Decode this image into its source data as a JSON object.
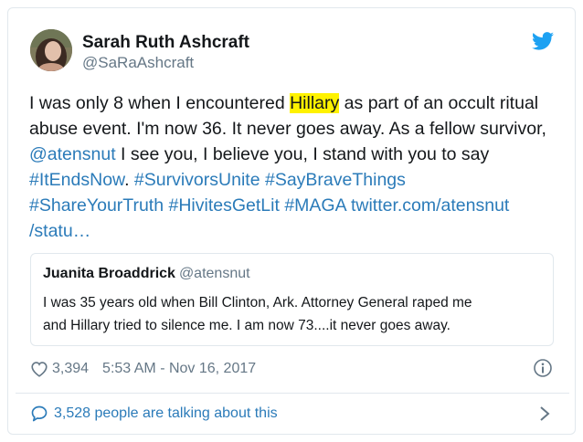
{
  "tweet": {
    "author_name": "Sarah Ruth Ashcraft",
    "author_handle": "@SaRaAshcraft",
    "text": {
      "part1": "I was only 8 when I encountered ",
      "highlight": "Hillary",
      "part2": " as part of an occult ritual abuse event. I'm now 36. It never goes away. As a fellow survivor, ",
      "mention": "@atensnut",
      "part3": " I see you, I believe you, I stand with you to say ",
      "hashtags": [
        "#ItEndsNow",
        "#SurvivorsUnite",
        "#SayBraveThings",
        "#ShareYourTruth",
        "#HivitesGetLit",
        "#MAGA"
      ],
      "link_line1": "twitter.com/atensnut",
      "link_line2": "/statu…"
    },
    "likes": "3,394",
    "timestamp": "5:53 AM - Nov 16, 2017",
    "talking_label": "3,528 people are talking about this"
  },
  "quoted_tweet": {
    "author_name": "Juanita Broaddrick",
    "author_handle": "@atensnut",
    "text_line1": "I was 35 years old when Bill Clinton, Ark. Attorney General raped me",
    "text_line2": "and Hillary tried to silence me.  I am now 73....it never goes away."
  },
  "icons": {
    "brand": "twitter-bird-icon",
    "like": "heart-icon",
    "info": "info-icon",
    "reply": "speech-bubble-icon",
    "more": "chevron-right-icon"
  },
  "colors": {
    "link": "#2b7bb9",
    "twitter_blue": "#1da1f2",
    "highlight": "#fff200",
    "secondary_text": "#657786",
    "border": "#e1e8ed"
  }
}
